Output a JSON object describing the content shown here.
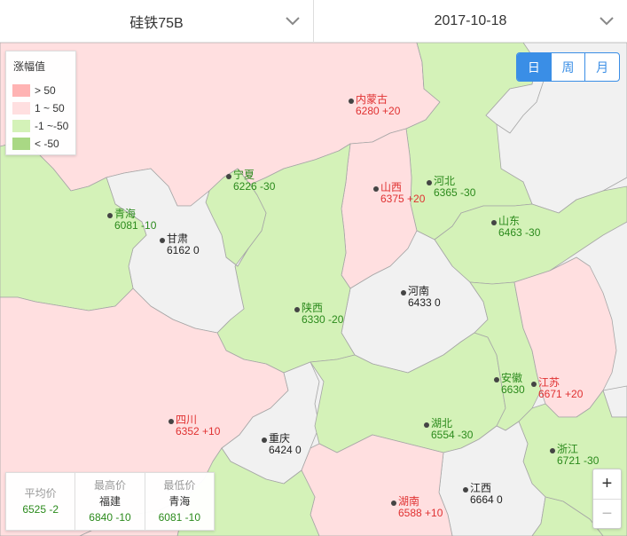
{
  "filters": {
    "product": "硅铁75B",
    "date": "2017-10-18"
  },
  "period_buttons": [
    {
      "label": "日",
      "active": true
    },
    {
      "label": "周",
      "active": false
    },
    {
      "label": "月",
      "active": false
    }
  ],
  "legend": {
    "title": "涨幅值",
    "items": [
      {
        "label": "> 50",
        "color": "#ffb3b3"
      },
      {
        "label": "1 ~ 50",
        "color": "#ffdfe0"
      },
      {
        "label": "-1 ~-50",
        "color": "#d4f2b8"
      },
      {
        "label": "< -50",
        "color": "#a9d884"
      }
    ]
  },
  "region_colors": {
    "flat": "#f1f1f1",
    "up": "#ffdfe0",
    "down": "#d4f2b8",
    "border": "#a6a6a6"
  },
  "provinces": [
    {
      "name": "内蒙古",
      "value": "6280 +20",
      "trend": "up"
    },
    {
      "name": "宁夏",
      "value": "6226 -30",
      "trend": "down"
    },
    {
      "name": "山西",
      "value": "6375 +20",
      "trend": "up"
    },
    {
      "name": "河北",
      "value": "6365 -30",
      "trend": "down"
    },
    {
      "name": "青海",
      "value": "6081 -10",
      "trend": "down"
    },
    {
      "name": "甘肃",
      "value": "6162 0",
      "trend": "flat"
    },
    {
      "name": "山东",
      "value": "6463 -30",
      "trend": "down"
    },
    {
      "name": "河南",
      "value": "6433 0",
      "trend": "flat"
    },
    {
      "name": "陕西",
      "value": "6330 -20",
      "trend": "down"
    },
    {
      "name": "安徽",
      "value": "6630",
      "trend": "down"
    },
    {
      "name": "江苏",
      "value": "6671 +20",
      "trend": "up"
    },
    {
      "name": "四川",
      "value": "6352 +10",
      "trend": "up"
    },
    {
      "name": "重庆",
      "value": "6424 0",
      "trend": "flat"
    },
    {
      "name": "湖北",
      "value": "6554 -30",
      "trend": "down"
    },
    {
      "name": "浙江",
      "value": "6721 -30",
      "trend": "down"
    },
    {
      "name": "湖南",
      "value": "6588 +10",
      "trend": "up"
    },
    {
      "name": "江西",
      "value": "6664 0",
      "trend": "flat"
    }
  ],
  "stats": {
    "avg": {
      "label": "平均价",
      "value": "6525 -2"
    },
    "max": {
      "label": "最高价",
      "province": "福建",
      "value": "6840 -10"
    },
    "min": {
      "label": "最低价",
      "province": "青海",
      "value": "6081 -10"
    }
  },
  "zoom": {
    "in": "+",
    "out": "−"
  }
}
